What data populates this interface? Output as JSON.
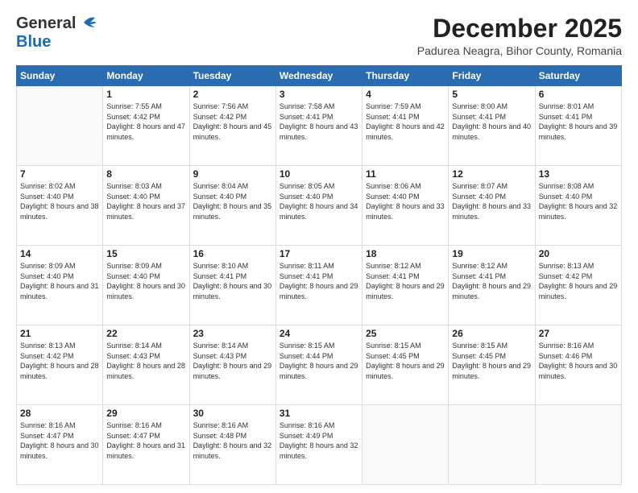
{
  "logo": {
    "general": "General",
    "blue": "Blue"
  },
  "title": {
    "month_year": "December 2025",
    "location": "Padurea Neagra, Bihor County, Romania"
  },
  "days_of_week": [
    "Sunday",
    "Monday",
    "Tuesday",
    "Wednesday",
    "Thursday",
    "Friday",
    "Saturday"
  ],
  "weeks": [
    [
      {
        "day": "",
        "sunrise": "",
        "sunset": "",
        "daylight": ""
      },
      {
        "day": "1",
        "sunrise": "Sunrise: 7:55 AM",
        "sunset": "Sunset: 4:42 PM",
        "daylight": "Daylight: 8 hours and 47 minutes."
      },
      {
        "day": "2",
        "sunrise": "Sunrise: 7:56 AM",
        "sunset": "Sunset: 4:42 PM",
        "daylight": "Daylight: 8 hours and 45 minutes."
      },
      {
        "day": "3",
        "sunrise": "Sunrise: 7:58 AM",
        "sunset": "Sunset: 4:41 PM",
        "daylight": "Daylight: 8 hours and 43 minutes."
      },
      {
        "day": "4",
        "sunrise": "Sunrise: 7:59 AM",
        "sunset": "Sunset: 4:41 PM",
        "daylight": "Daylight: 8 hours and 42 minutes."
      },
      {
        "day": "5",
        "sunrise": "Sunrise: 8:00 AM",
        "sunset": "Sunset: 4:41 PM",
        "daylight": "Daylight: 8 hours and 40 minutes."
      },
      {
        "day": "6",
        "sunrise": "Sunrise: 8:01 AM",
        "sunset": "Sunset: 4:41 PM",
        "daylight": "Daylight: 8 hours and 39 minutes."
      }
    ],
    [
      {
        "day": "7",
        "sunrise": "Sunrise: 8:02 AM",
        "sunset": "Sunset: 4:40 PM",
        "daylight": "Daylight: 8 hours and 38 minutes."
      },
      {
        "day": "8",
        "sunrise": "Sunrise: 8:03 AM",
        "sunset": "Sunset: 4:40 PM",
        "daylight": "Daylight: 8 hours and 37 minutes."
      },
      {
        "day": "9",
        "sunrise": "Sunrise: 8:04 AM",
        "sunset": "Sunset: 4:40 PM",
        "daylight": "Daylight: 8 hours and 35 minutes."
      },
      {
        "day": "10",
        "sunrise": "Sunrise: 8:05 AM",
        "sunset": "Sunset: 4:40 PM",
        "daylight": "Daylight: 8 hours and 34 minutes."
      },
      {
        "day": "11",
        "sunrise": "Sunrise: 8:06 AM",
        "sunset": "Sunset: 4:40 PM",
        "daylight": "Daylight: 8 hours and 33 minutes."
      },
      {
        "day": "12",
        "sunrise": "Sunrise: 8:07 AM",
        "sunset": "Sunset: 4:40 PM",
        "daylight": "Daylight: 8 hours and 33 minutes."
      },
      {
        "day": "13",
        "sunrise": "Sunrise: 8:08 AM",
        "sunset": "Sunset: 4:40 PM",
        "daylight": "Daylight: 8 hours and 32 minutes."
      }
    ],
    [
      {
        "day": "14",
        "sunrise": "Sunrise: 8:09 AM",
        "sunset": "Sunset: 4:40 PM",
        "daylight": "Daylight: 8 hours and 31 minutes."
      },
      {
        "day": "15",
        "sunrise": "Sunrise: 8:09 AM",
        "sunset": "Sunset: 4:40 PM",
        "daylight": "Daylight: 8 hours and 30 minutes."
      },
      {
        "day": "16",
        "sunrise": "Sunrise: 8:10 AM",
        "sunset": "Sunset: 4:41 PM",
        "daylight": "Daylight: 8 hours and 30 minutes."
      },
      {
        "day": "17",
        "sunrise": "Sunrise: 8:11 AM",
        "sunset": "Sunset: 4:41 PM",
        "daylight": "Daylight: 8 hours and 29 minutes."
      },
      {
        "day": "18",
        "sunrise": "Sunrise: 8:12 AM",
        "sunset": "Sunset: 4:41 PM",
        "daylight": "Daylight: 8 hours and 29 minutes."
      },
      {
        "day": "19",
        "sunrise": "Sunrise: 8:12 AM",
        "sunset": "Sunset: 4:41 PM",
        "daylight": "Daylight: 8 hours and 29 minutes."
      },
      {
        "day": "20",
        "sunrise": "Sunrise: 8:13 AM",
        "sunset": "Sunset: 4:42 PM",
        "daylight": "Daylight: 8 hours and 29 minutes."
      }
    ],
    [
      {
        "day": "21",
        "sunrise": "Sunrise: 8:13 AM",
        "sunset": "Sunset: 4:42 PM",
        "daylight": "Daylight: 8 hours and 28 minutes."
      },
      {
        "day": "22",
        "sunrise": "Sunrise: 8:14 AM",
        "sunset": "Sunset: 4:43 PM",
        "daylight": "Daylight: 8 hours and 28 minutes."
      },
      {
        "day": "23",
        "sunrise": "Sunrise: 8:14 AM",
        "sunset": "Sunset: 4:43 PM",
        "daylight": "Daylight: 8 hours and 29 minutes."
      },
      {
        "day": "24",
        "sunrise": "Sunrise: 8:15 AM",
        "sunset": "Sunset: 4:44 PM",
        "daylight": "Daylight: 8 hours and 29 minutes."
      },
      {
        "day": "25",
        "sunrise": "Sunrise: 8:15 AM",
        "sunset": "Sunset: 4:45 PM",
        "daylight": "Daylight: 8 hours and 29 minutes."
      },
      {
        "day": "26",
        "sunrise": "Sunrise: 8:15 AM",
        "sunset": "Sunset: 4:45 PM",
        "daylight": "Daylight: 8 hours and 29 minutes."
      },
      {
        "day": "27",
        "sunrise": "Sunrise: 8:16 AM",
        "sunset": "Sunset: 4:46 PM",
        "daylight": "Daylight: 8 hours and 30 minutes."
      }
    ],
    [
      {
        "day": "28",
        "sunrise": "Sunrise: 8:16 AM",
        "sunset": "Sunset: 4:47 PM",
        "daylight": "Daylight: 8 hours and 30 minutes."
      },
      {
        "day": "29",
        "sunrise": "Sunrise: 8:16 AM",
        "sunset": "Sunset: 4:47 PM",
        "daylight": "Daylight: 8 hours and 31 minutes."
      },
      {
        "day": "30",
        "sunrise": "Sunrise: 8:16 AM",
        "sunset": "Sunset: 4:48 PM",
        "daylight": "Daylight: 8 hours and 32 minutes."
      },
      {
        "day": "31",
        "sunrise": "Sunrise: 8:16 AM",
        "sunset": "Sunset: 4:49 PM",
        "daylight": "Daylight: 8 hours and 32 minutes."
      },
      {
        "day": "",
        "sunrise": "",
        "sunset": "",
        "daylight": ""
      },
      {
        "day": "",
        "sunrise": "",
        "sunset": "",
        "daylight": ""
      },
      {
        "day": "",
        "sunrise": "",
        "sunset": "",
        "daylight": ""
      }
    ]
  ]
}
